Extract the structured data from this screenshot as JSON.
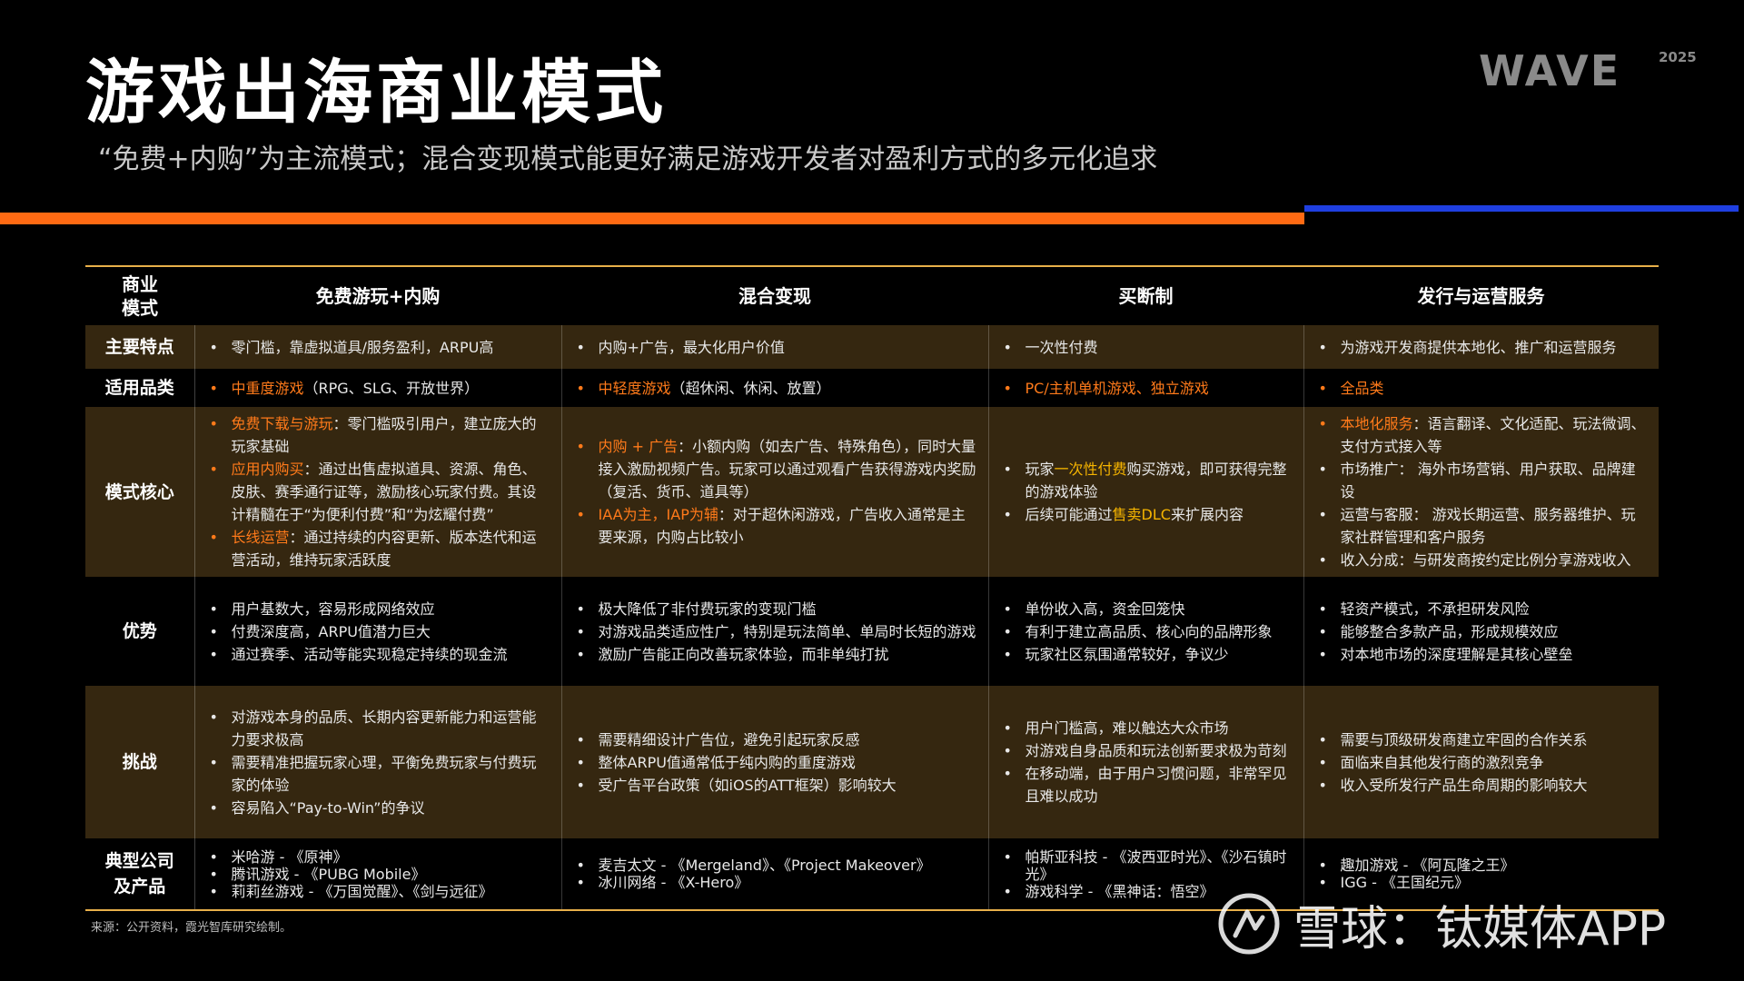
{
  "page": {
    "title": "游戏出海商业模式",
    "subtitle": "“免费+内购”为主流模式；混合变现模式能更好满足游戏开发者对盈利方式的多元化追求",
    "logo_text": "WAVE",
    "logo_year": "2025",
    "accent_orange": "#ff6a13",
    "accent_blue": "#1f3fe0",
    "table_border": "#e8b04a",
    "band_color": "#352710"
  },
  "table": {
    "headers": [
      "商业\n模式",
      "免费游玩+内购",
      "混合变现",
      "买断制",
      "发行与运营服务"
    ],
    "feature": {
      "label": "主要特点",
      "cells": [
        "零门槛，靠虚拟道具/服务盈利，ARPU高",
        "内购+广告，最大化用户价值",
        "一次性付费",
        "为游戏开发商提供本地化、推广和运营服务"
      ]
    },
    "category": {
      "label": "适用品类",
      "cells": [
        {
          "hl": "中重度游戏",
          "rest": "（RPG、SLG、开放世界）"
        },
        {
          "hl": "中轻度游戏",
          "rest": "（超休闲、休闲、放置）"
        },
        {
          "hl": "PC/主机单机游戏、独立游戏",
          "rest": ""
        },
        {
          "hl": "全品类",
          "rest": ""
        }
      ]
    },
    "core": {
      "label": "模式核心",
      "col1": [
        {
          "hl": "免费下载与游玩",
          "rest": "：零门槛吸引用户，建立庞大的玩家基础"
        },
        {
          "hl": "应用内购买",
          "rest": "：通过出售虚拟道具、资源、角色、皮肤、赛季通行证等，激励核心玩家付费。其设计精髓在于“为便利付费”和“为炫耀付费”"
        },
        {
          "hl": "长线运营",
          "rest": "：通过持续的内容更新、版本迭代和运营活动，维持玩家活跃度"
        }
      ],
      "col2": [
        {
          "hl": "内购 + 广告",
          "rest": "：小额内购（如去广告、特殊角色），同时大量接入激励视频广告。玩家可以通过观看广告获得游戏内奖励（复活、货币、道具等）"
        },
        {
          "hl": "IAA为主，IAP为辅",
          "rest": "：对于超休闲游戏，广告收入通常是主要来源，内购占比较小"
        }
      ],
      "col3": [
        {
          "pre": "玩家",
          "hl": "一次性付费",
          "rest": "购买游戏，即可获得完整的游戏体验"
        },
        {
          "pre": "后续可能通过",
          "hl": "售卖DLC",
          "rest": "来扩展内容"
        }
      ],
      "col4": [
        {
          "hl": "本地化服务",
          "rest": "：语言翻译、文化适配、玩法微调、支付方式接入等"
        },
        {
          "hl": "",
          "rest": "市场推广： 海外市场营销、用户获取、品牌建设"
        },
        {
          "hl": "",
          "rest": "运营与客服： 游戏长期运营、服务器维护、玩家社群管理和客户服务"
        },
        {
          "hl": "",
          "rest": "收入分成：与研发商按约定比例分享游戏收入"
        }
      ]
    },
    "advantage": {
      "label": "优势",
      "col1": [
        "用户基数大，容易形成网络效应",
        "付费深度高，ARPU值潜力巨大",
        "通过赛季、活动等能实现稳定持续的现金流"
      ],
      "col2": [
        "极大降低了非付费玩家的变现门槛",
        "对游戏品类适应性广，特别是玩法简单、单局时长短的游戏",
        "激励广告能正向改善玩家体验，而非单纯打扰"
      ],
      "col3": [
        "单份收入高，资金回笼快",
        "有利于建立高品质、核心向的品牌形象",
        "玩家社区氛围通常较好，争议少"
      ],
      "col4": [
        "轻资产模式，不承担研发风险",
        "能够整合多款产品，形成规模效应",
        "对本地市场的深度理解是其核心壁垒"
      ]
    },
    "challenge": {
      "label": "挑战",
      "col1": [
        "对游戏本身的品质、长期内容更新能力和运营能力要求极高",
        "需要精准把握玩家心理，平衡免费玩家与付费玩家的体验",
        "容易陷入“Pay-to-Win”的争议"
      ],
      "col2": [
        "需要精细设计广告位，避免引起玩家反感",
        "整体ARPU值通常低于纯内购的重度游戏",
        "受广告平台政策（如iOS的ATT框架）影响较大"
      ],
      "col3": [
        "用户门槛高，难以触达大众市场",
        "对游戏自身品质和玩法创新要求极为苛刻",
        "在移动端，由于用户习惯问题，非常罕见且难以成功"
      ],
      "col4": [
        "需要与顶级研发商建立牢固的合作关系",
        "面临来自其他发行商的激烈竞争",
        "收入受所发行产品生命周期的影响较大"
      ]
    },
    "companies": {
      "label": "典型公司\n及产品",
      "col1": [
        "米哈游 - 《原神》",
        "腾讯游戏 - 《PUBG Mobile》",
        "莉莉丝游戏 - 《万国觉醒》、《剑与远征》"
      ],
      "col2": [
        "麦吉太文 - 《Mergeland》、《Project Makeover》",
        "冰川网络 - 《X-Hero》"
      ],
      "col3": [
        "帕斯亚科技 - 《波西亚时光》、《沙石镇时光》",
        "游戏科学 - 《黑神话：悟空》"
      ],
      "col4": [
        "趣加游戏 - 《阿瓦隆之王》",
        "IGG - 《王国纪元》"
      ]
    }
  },
  "footer": {
    "source": "来源：公开资料，霞光智库研究绘制。",
    "watermark": "雪球：钛媒体APP",
    "watermark_icon": "snowball-logo-icon"
  }
}
